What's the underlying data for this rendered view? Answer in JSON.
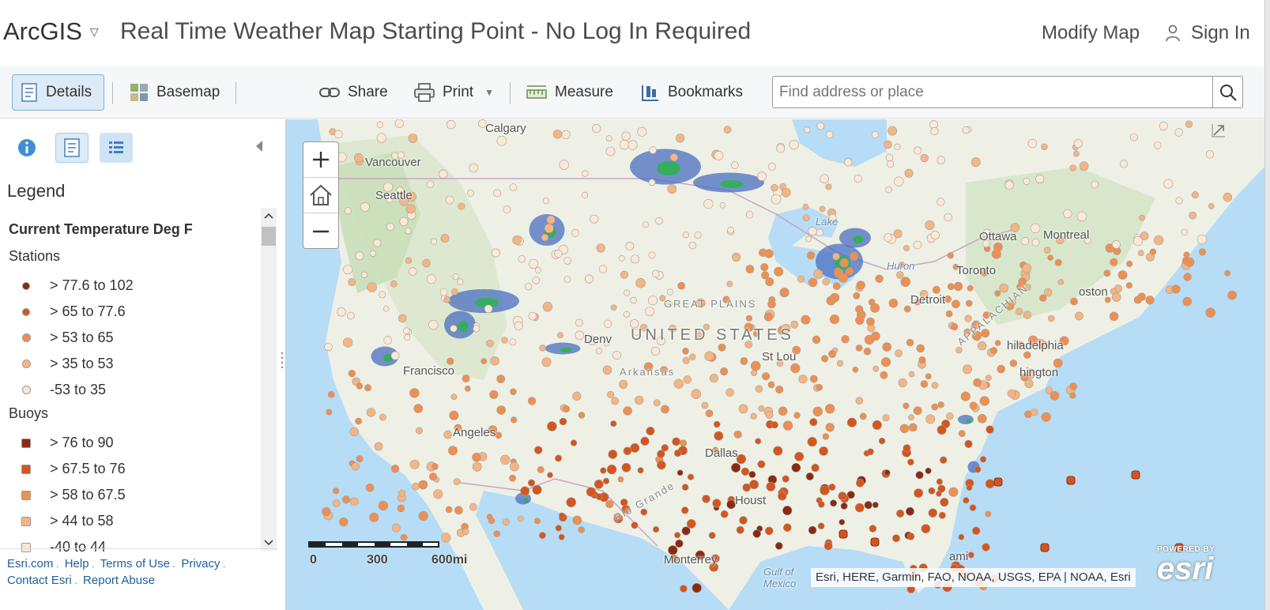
{
  "header": {
    "brand": "ArcGIS",
    "title": "Real Time Weather Map Starting Point - No Log In Required",
    "modify_map": "Modify Map",
    "sign_in": "Sign In"
  },
  "toolbar": {
    "details": "Details",
    "basemap": "Basemap",
    "share": "Share",
    "print": "Print",
    "measure": "Measure",
    "bookmarks": "Bookmarks",
    "search_placeholder": "Find address or place"
  },
  "sidebar": {
    "legend_heading": "Legend",
    "layer_title": "Current Temperature Deg F",
    "stations_title": "Stations",
    "stations": [
      {
        "label": "> 77.6 to 102",
        "color": "#8b2a12"
      },
      {
        "label": "> 65 to 77.6",
        "color": "#d4561e"
      },
      {
        "label": "> 53 to 65",
        "color": "#ee8f52"
      },
      {
        "label": "> 35 to 53",
        "color": "#f4b583"
      },
      {
        "label": "-53 to 35",
        "color": "#fde8d4"
      }
    ],
    "buoys_title": "Buoys",
    "buoys": [
      {
        "label": "> 76 to 90",
        "color": "#8b2a12"
      },
      {
        "label": "> 67.5 to 76",
        "color": "#d4561e"
      },
      {
        "label": "> 58 to 67.5",
        "color": "#ee8f52"
      },
      {
        "label": "> 44 to 58",
        "color": "#f4b583"
      },
      {
        "label": "-40 to 44",
        "color": "#fde8d4"
      }
    ],
    "footer": {
      "esri": "Esri.com",
      "help": "Help",
      "terms": "Terms of Use",
      "privacy": "Privacy",
      "contact": "Contact Esri",
      "report": "Report Abuse"
    }
  },
  "map": {
    "labels": {
      "calgary": "Calgary",
      "vancouver": "Vancouver",
      "seattle": "Seattle",
      "ottawa": "Ottawa",
      "montreal": "Montreal",
      "toronto": "Toronto",
      "boston": "oston",
      "detroit": "Detroit",
      "philadelphia": "hiladelphia",
      "washington": "hington",
      "stlouis": "St Lou",
      "denver": "Denv",
      "san_francisco": "Francisco",
      "los_angeles": "Angeles",
      "dallas": "Dallas",
      "houston": "Houst",
      "monterrey": "Monterrey",
      "miami": "ami",
      "united_states": "UNITED STATES",
      "great_plains": "GREAT PLAINS",
      "arkansas": "Arkansas",
      "lake": "Lake",
      "huron": "Huron",
      "gulf": "Gulf of Mexico",
      "rio": "Rio Grande",
      "appalachian": "APPALACHIAN"
    },
    "scale": {
      "zero": "0",
      "mid": "300",
      "max": "600mi"
    },
    "attribution": "Esri, HERE, Garmin, FAO, NOAA, USGS, EPA | NOAA, Esri",
    "powered_by": "POWERED BY",
    "esri_logo": "esri"
  },
  "colors": {
    "land": "#eef0e6",
    "water": "#b7dcf5",
    "accent": "#1f5f99",
    "radar_blue": "#4a6fc0",
    "radar_green": "#2cb34a"
  }
}
